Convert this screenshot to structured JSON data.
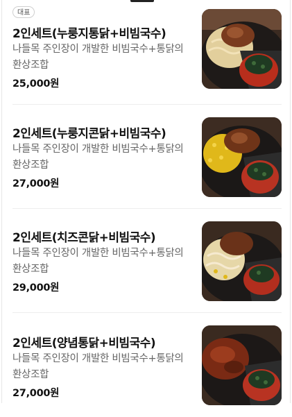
{
  "items": [
    {
      "badge": "대표",
      "name": "2인세트(누룽지통닭+비빔국수)",
      "desc": "나들목 주인장이 개발한 비빔국수+통닭의 환상조합",
      "price": "25,000원",
      "image": "photo-roast-chicken-nurungji-bibim-noodles"
    },
    {
      "name": "2인세트(누룽지콘닭+비빔국수)",
      "desc": "나들목 주인장이 개발한 비빔국수+통닭의 환상조합",
      "price": "27,000원",
      "image": "photo-roast-chicken-corn-bibim-noodles"
    },
    {
      "name": "2인세트(치즈콘닭+비빔국수)",
      "desc": "나들목 주인장이 개발한 비빔국수+통닭의 환상조합",
      "price": "29,000원",
      "image": "photo-cheese-corn-chicken-bibim-noodles"
    },
    {
      "name": "2인세트(양념통닭+비빔국수)",
      "desc": "나들목 주인장이 개발한 비빔국수+통닭의 환상조합",
      "price": "27,000원",
      "image": "photo-seasoned-chicken-bibim-noodles"
    }
  ]
}
